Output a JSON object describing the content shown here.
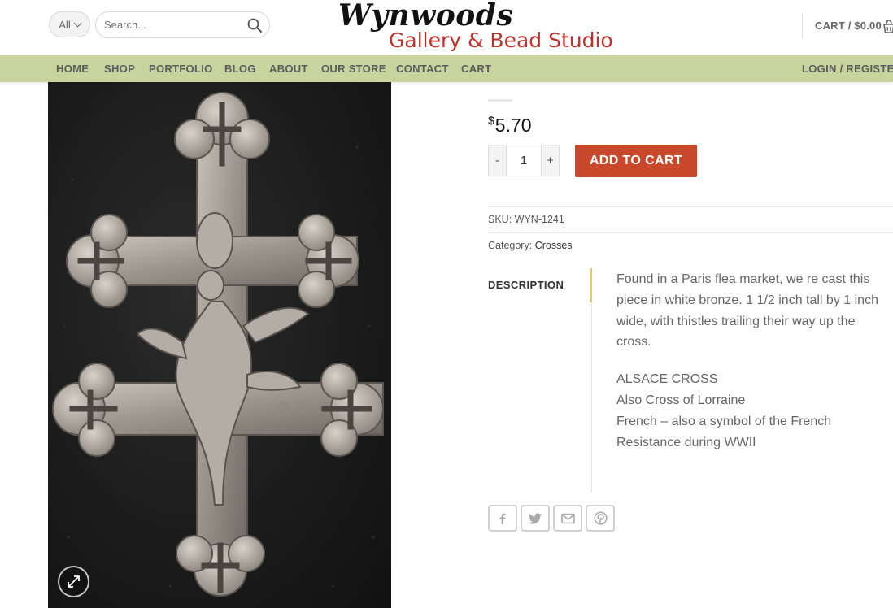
{
  "header": {
    "search": {
      "category_label": "All",
      "placeholder": "Search..."
    },
    "logo": {
      "line1": "Wynwoods",
      "line2": "Gallery & Bead Studio"
    },
    "cart_label": "CART / $0.00"
  },
  "nav": {
    "items": [
      {
        "label": "HOME"
      },
      {
        "label": "SHOP"
      },
      {
        "label": "PORTFOLIO"
      },
      {
        "label": "BLOG"
      },
      {
        "label": "ABOUT"
      },
      {
        "label": "OUR STORE"
      },
      {
        "label": "CONTACT"
      },
      {
        "label": "CART"
      }
    ],
    "login_label": "LOGIN / REGISTER"
  },
  "product": {
    "price_currency": "$",
    "price_amount": "5.70",
    "quantity": "1",
    "qty_minus": "-",
    "qty_plus": "+",
    "add_to_cart": "ADD TO CART",
    "sku_label": "SKU:",
    "sku_value": "WYN-1241",
    "category_label": "Category:",
    "category_value": "Crosses",
    "tab_label": "DESCRIPTION",
    "description": {
      "para1": "Found in a Paris flea market, we re cast this piece in white bronze. 1 1/2 inch tall by 1 inch wide, with thistles trailing their way up the cross.",
      "line1": "ALSACE CROSS",
      "line2": "Also Cross of Lorraine",
      "line3": "French – also a symbol of the French Resistance during WWII"
    }
  },
  "share_icons": [
    "facebook-icon",
    "twitter-icon",
    "email-icon",
    "pinterest-icon"
  ],
  "colors": {
    "nav_bg": "#c9d39d",
    "add_to_cart_bg": "#c9482b",
    "logo_red": "#c2302a",
    "tab_accent": "#f0c36a"
  }
}
